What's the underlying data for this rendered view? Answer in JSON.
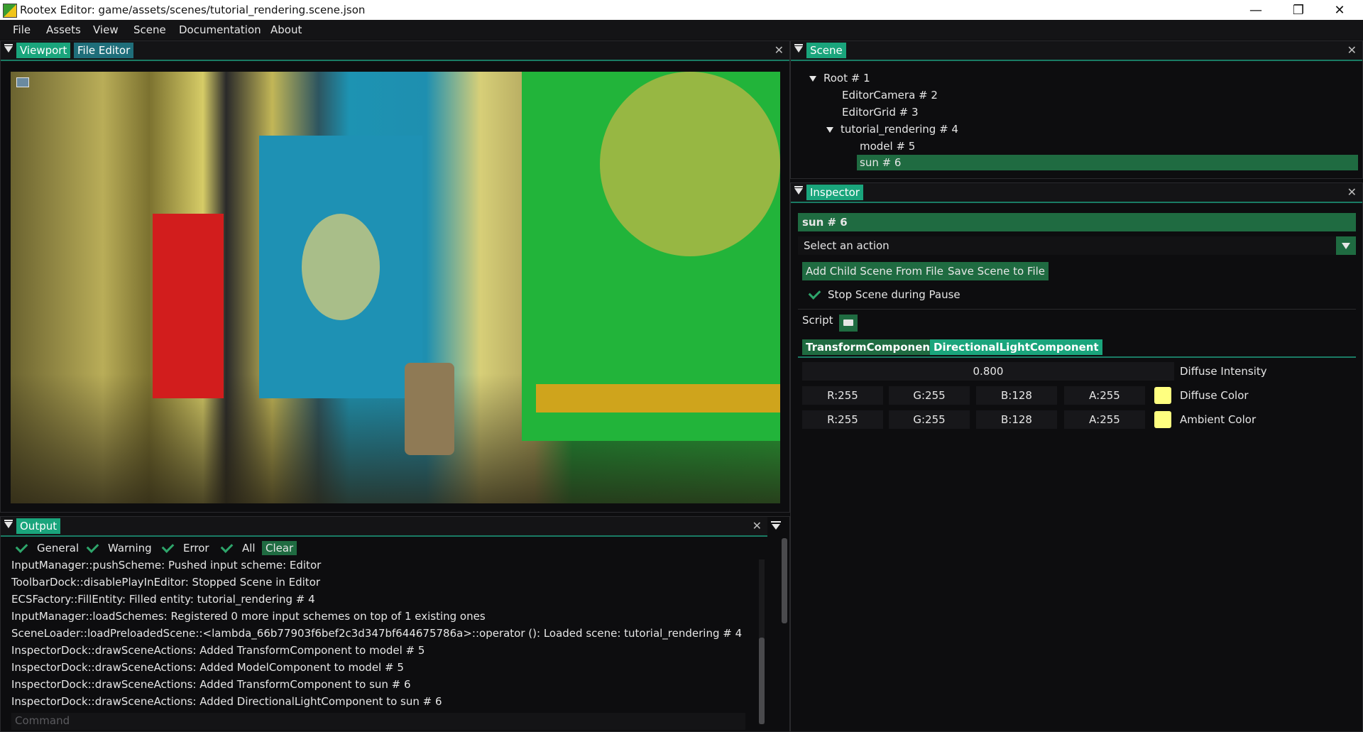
{
  "window": {
    "title": "Rootex Editor: game/assets/scenes/tutorial_rendering.scene.json",
    "controls": [
      "—",
      "❐",
      "✕"
    ]
  },
  "menu": [
    "File",
    "Assets",
    "View",
    "Scene",
    "Documentation",
    "About"
  ],
  "viewport_dock": {
    "tabs": [
      "Viewport",
      "File Editor"
    ],
    "close": "✕"
  },
  "scene_dock": {
    "tab": "Scene",
    "close": "✕",
    "tree": [
      {
        "label": "Root # 1"
      },
      {
        "label": "EditorCamera # 2"
      },
      {
        "label": "EditorGrid # 3"
      },
      {
        "label": "tutorial_rendering # 4"
      },
      {
        "label": "model # 5"
      },
      {
        "label": "sun # 6"
      }
    ]
  },
  "inspector": {
    "tab": "Inspector",
    "close": "✕",
    "entity_name": "sun # 6",
    "action_placeholder": "Select an action",
    "buttons": {
      "add_child": "Add Child Scene From File",
      "save_scene": "Save Scene to File"
    },
    "stop_scene_label": "Stop Scene during Pause",
    "script_label": "Script",
    "component_tabs": [
      "TransformComponent",
      "DirectionalLightComponent"
    ],
    "diffuse_intensity": {
      "value": "0.800",
      "label": "Diffuse Intensity"
    },
    "diffuse_color": {
      "r": "R:255",
      "g": "G:255",
      "b": "B:128",
      "a": "A:255",
      "label": "Diffuse Color",
      "hex": "#ffff80"
    },
    "ambient_color": {
      "r": "R:255",
      "g": "G:255",
      "b": "B:128",
      "a": "A:255",
      "label": "Ambient Color",
      "hex": "#ffff80"
    }
  },
  "output": {
    "tab": "Output",
    "close": "✕",
    "filters": [
      "General",
      "Warning",
      "Error",
      "All"
    ],
    "clear": "Clear",
    "lines": [
      "InputManager::pushScheme: Pushed input scheme: Editor",
      "ToolbarDock::disablePlayInEditor: Stopped Scene in Editor",
      "ECSFactory::FillEntity: Filled entity: tutorial_rendering # 4",
      "InputManager::loadSchemes: Registered 0 more input schemes on top of 1 existing ones",
      "SceneLoader::loadPreloadedScene::<lambda_66b77903f6bef2c3d347bf644675786a>::operator (): Loaded scene: tutorial_rendering # 4",
      "InspectorDock::drawSceneActions: Added TransformComponent to model # 5",
      "InspectorDock::drawSceneActions: Added ModelComponent to model # 5",
      "InspectorDock::drawSceneActions: Added TransformComponent to sun # 6",
      "InspectorDock::drawSceneActions: Added DirectionalLightComponent to sun # 6"
    ],
    "command_placeholder": "Command"
  },
  "colors": {
    "accent": "#1aa57c",
    "tab_inactive": "#1f6e7a",
    "selected": "#1f6b41",
    "background": "#0d0d0f"
  }
}
